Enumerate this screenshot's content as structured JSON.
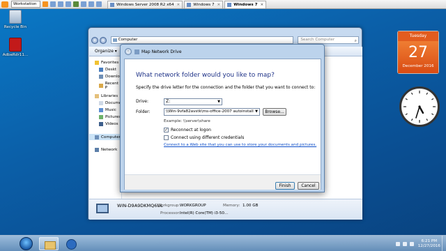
{
  "vmware": {
    "title": "Workstation",
    "tabs": [
      {
        "label": "Windows Server 2008 R2 x64"
      },
      {
        "label": "Windows 7"
      },
      {
        "label": "Windows 7"
      }
    ]
  },
  "desktop": {
    "icons": [
      {
        "label": "Recycle Bin"
      },
      {
        "label": "AdbeRdr11..."
      }
    ]
  },
  "explorer": {
    "address": "Computer",
    "search_placeholder": "Search Computer",
    "organize": "Organize",
    "sidebar": {
      "favorites": "Favorites",
      "fav_items": [
        "Deskt",
        "Downlo",
        "Recent P"
      ],
      "libraries": "Libraries",
      "lib_items": [
        "Documen",
        "Music",
        "Pictures",
        "Videos"
      ],
      "computer": "Computer",
      "network": "Network"
    },
    "details": {
      "pc_name": "WIN-D9A9DKMQ6UL",
      "workgroup_label": "Workgroup:",
      "workgroup": "WORKGROUP",
      "memory_label": "Memory:",
      "memory": "1.00 GB",
      "processor_label": "Processor:",
      "processor": "Intel(R) Core(TM) i3-50..."
    }
  },
  "dialog": {
    "title": "Map Network Drive",
    "heading": "What network folder would you like to map?",
    "description": "Specify the drive letter for the connection and the folder that you want to connect to:",
    "drive_label": "Drive:",
    "drive_value": "Z:",
    "folder_label": "Folder:",
    "folder_value": "\\\\Win-9vfa82avstk\\ms-office-2007 autoinstall",
    "browse": "Browse...",
    "example": "Example: \\\\server\\share",
    "reconnect": "Reconnect at logon",
    "reconnect_checked": true,
    "different_credentials": "Connect using different credentials",
    "different_checked": false,
    "link": "Connect to a Web site that you can use to store your documents and pictures.",
    "finish": "Finish",
    "cancel": "Cancel"
  },
  "calendar": {
    "weekday": "Tuesday",
    "day": "27",
    "month_year": "December 2016"
  },
  "taskbar": {
    "time": "6:21 PM",
    "date": "12/27/2016"
  }
}
